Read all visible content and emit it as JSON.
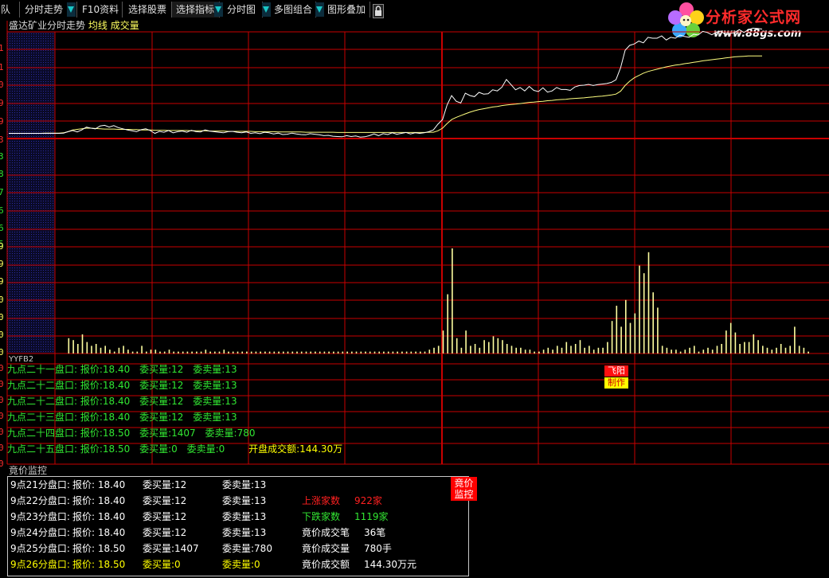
{
  "toolbar": {
    "items": [
      {
        "label": "队",
        "dropdown": false
      },
      {
        "label": "分时走势",
        "dropdown": true
      },
      {
        "label": "F10资料",
        "dropdown": true
      },
      {
        "label": "选择股票",
        "dropdown": false
      },
      {
        "label": "选择指标",
        "dropdown": false
      },
      {
        "label": "分时图",
        "dropdown": false
      },
      {
        "label": "多图组合",
        "dropdown": true
      },
      {
        "label": "图形叠加",
        "dropdown": true
      }
    ],
    "lock_icon": "lock-icon"
  },
  "logo": {
    "title": "分析家公式网",
    "url": "www.88gs.com",
    "icon": "flower-logo-icon"
  },
  "chart_header": {
    "stock": "盛达矿业",
    "mode": "分时走势",
    "avg": "均线",
    "vol": "成交量"
  },
  "indicator_name": "YYFB2",
  "colors": {
    "grid": "#c80000",
    "price": "#ffffff",
    "avg": "#ffff80",
    "volume": "#ffffa0",
    "green": "#32e632",
    "yellow": "#ffff00",
    "red": "#ff2020",
    "panel_border": "#c8c8c8"
  },
  "chart_data": {
    "type": "line",
    "series": [
      {
        "values": [
          0.18,
          0.18,
          0.18,
          0.18,
          0.18,
          0.18,
          0.18,
          0.18,
          0.18,
          0.18,
          0.18,
          0.18,
          0.19,
          0.24,
          0.28,
          0.23,
          0.3,
          0.4,
          0.36,
          0.34,
          0.44,
          0.46,
          0.4,
          0.45,
          0.38,
          0.34,
          0.3,
          0.27,
          0.24,
          0.31,
          0.34,
          0.28,
          0.18,
          0.25,
          0.22,
          0.28,
          0.2,
          0.24,
          0.26,
          0.22,
          0.29,
          0.24,
          0.23,
          0.3,
          0.26,
          0.24,
          0.22,
          0.2,
          0.24,
          0.25,
          0.22,
          0.2,
          0.23,
          0.18,
          0.2,
          0.17,
          0.22,
          0.2,
          0.16,
          0.19,
          0.14,
          0.15,
          0.19,
          0.16,
          0.14,
          0.13,
          0.17,
          0.15,
          0.13,
          0.1,
          0.11,
          0.08,
          0.07,
          0.06,
          0.1,
          0.07,
          0.09,
          0.05,
          0.06,
          0.1,
          0.16,
          0.1,
          0.17,
          0.14,
          0.2,
          0.15,
          0.18,
          0.21,
          0.16,
          0.2,
          0.18,
          0.2,
          0.24,
          0.3,
          0.5,
          0.66,
          1.17,
          1.5,
          1.3,
          1.24,
          1.58,
          1.5,
          1.46,
          1.61,
          1.55,
          1.56,
          1.7,
          1.66,
          1.79,
          2.06,
          1.88,
          1.7,
          1.78,
          1.66,
          1.82,
          1.68,
          1.64,
          1.77,
          1.62,
          1.66,
          1.78,
          1.71,
          1.71,
          1.68,
          1.8,
          1.85,
          1.86,
          1.89,
          1.85,
          1.88,
          1.9,
          1.92,
          1.96,
          2.05,
          2.47,
          3.08,
          3.25,
          3.3,
          3.4,
          3.34,
          3.53,
          3.5,
          3.5,
          3.58,
          3.44,
          3.53,
          3.5,
          3.61,
          3.56,
          3.53,
          3.64,
          3.61,
          3.74,
          3.7,
          3.62,
          3.71,
          3.75,
          3.61,
          3.66,
          3.7,
          3.8,
          3.7,
          3.8,
          3.85,
          3.84,
          3.82
        ]
      },
      {
        "values": [
          0.18,
          0.18,
          0.18,
          0.18,
          0.18,
          0.18,
          0.18,
          0.18,
          0.19,
          0.19,
          0.19,
          0.19,
          0.2,
          0.24,
          0.3,
          0.32,
          0.34,
          0.36,
          0.36,
          0.35,
          0.34,
          0.33,
          0.33,
          0.33,
          0.32,
          0.32,
          0.32,
          0.31,
          0.31,
          0.3,
          0.3,
          0.3,
          0.29,
          0.29,
          0.29,
          0.28,
          0.28,
          0.28,
          0.28,
          0.28,
          0.27,
          0.27,
          0.27,
          0.27,
          0.26,
          0.26,
          0.26,
          0.26,
          0.25,
          0.25,
          0.25,
          0.25,
          0.25,
          0.25,
          0.24,
          0.24,
          0.24,
          0.24,
          0.24,
          0.23,
          0.23,
          0.23,
          0.23,
          0.23,
          0.23,
          0.22,
          0.22,
          0.22,
          0.22,
          0.22,
          0.22,
          0.22,
          0.21,
          0.21,
          0.21,
          0.21,
          0.21,
          0.21,
          0.21,
          0.21,
          0.21,
          0.21,
          0.21,
          0.21,
          0.21,
          0.21,
          0.21,
          0.21,
          0.21,
          0.21,
          0.21,
          0.21,
          0.22,
          0.22,
          0.27,
          0.36,
          0.52,
          0.66,
          0.74,
          0.8,
          0.86,
          0.92,
          0.97,
          1.01,
          1.04,
          1.07,
          1.1,
          1.12,
          1.15,
          1.17,
          1.19,
          1.2,
          1.22,
          1.24,
          1.26,
          1.27,
          1.29,
          1.3,
          1.32,
          1.33,
          1.35,
          1.36,
          1.37,
          1.39,
          1.4,
          1.41,
          1.42,
          1.44,
          1.45,
          1.47,
          1.48,
          1.5,
          1.52,
          1.55,
          1.65,
          1.85,
          2.0,
          2.12,
          2.2,
          2.28,
          2.34,
          2.38,
          2.42,
          2.46,
          2.5,
          2.53,
          2.56,
          2.58,
          2.61,
          2.63,
          2.66,
          2.68,
          2.71,
          2.73,
          2.75,
          2.77,
          2.79,
          2.81,
          2.83,
          2.85,
          2.86,
          2.87,
          2.88,
          2.88,
          2.88,
          2.88
        ]
      }
    ],
    "volume": [
      0,
      0,
      0,
      0,
      0,
      0,
      0,
      0,
      0,
      0,
      0,
      0,
      0,
      8,
      7,
      5,
      10,
      6,
      4,
      5,
      3,
      4,
      2,
      1,
      3,
      4,
      2,
      1,
      1,
      4,
      1,
      2,
      2,
      1,
      1,
      2,
      1,
      1,
      1,
      1,
      1,
      1,
      1,
      2,
      1,
      1,
      1,
      2,
      1,
      1,
      1,
      1,
      1,
      1,
      1,
      1,
      1,
      1,
      1,
      1,
      1,
      1,
      1,
      1,
      1,
      1,
      1,
      1,
      1,
      1,
      1,
      1,
      1,
      1,
      1,
      1,
      1,
      1,
      1,
      1,
      1,
      1,
      1,
      1,
      1,
      1,
      1,
      1,
      1,
      1,
      1,
      1,
      2,
      3,
      4,
      12,
      31,
      55,
      8,
      3,
      12,
      4,
      5,
      3,
      7,
      6,
      9,
      8,
      7,
      5,
      4,
      3,
      3,
      2,
      2,
      1,
      1,
      2,
      3,
      2,
      4,
      3,
      6,
      4,
      5,
      7,
      3,
      4,
      2,
      3,
      3,
      6,
      17,
      25,
      14,
      28,
      16,
      21,
      46,
      42,
      53,
      32,
      24,
      4,
      3,
      2,
      2,
      1,
      2,
      3,
      4,
      1,
      2,
      3,
      2,
      4,
      5,
      12,
      16,
      11,
      5,
      6,
      6,
      10,
      7,
      4,
      3,
      2,
      3,
      5,
      3,
      4,
      14,
      4,
      3,
      1
    ]
  },
  "indicator_lines": [
    {
      "prefix": "九点二十一盘口:",
      "price": "报价:18.40",
      "buy": "委买量:12",
      "sell": "委卖量:13"
    },
    {
      "prefix": "九点二十二盘口:",
      "price": "报价:18.40",
      "buy": "委买量:12",
      "sell": "委卖量:13"
    },
    {
      "prefix": "九点二十二盘口:",
      "price": "报价:18.40",
      "buy": "委买量:12",
      "sell": "委卖量:13"
    },
    {
      "prefix": "九点二十三盘口:",
      "price": "报价:18.40",
      "buy": "委买量:12",
      "sell": "委卖量:13"
    },
    {
      "prefix": "九点二十四盘口:",
      "price": "报价:18.50",
      "buy": "委买量:1407",
      "sell": "委卖量:780"
    },
    {
      "prefix": "九点二十五盘口:",
      "price": "报价:18.50",
      "buy": "委买量:0",
      "sell": "委卖量:0"
    }
  ],
  "open_amount": "开盘成交额:144.30万",
  "badges": {
    "feiyang": "飞阳",
    "zhizuo": "制作"
  },
  "auction": {
    "title": "竟价监控",
    "corner": [
      "竟价",
      "监控"
    ],
    "rows": [
      {
        "time": "9点21分盘口:",
        "price": "报价: 18.40",
        "buy": "委买量:12",
        "sell": "委卖量:13"
      },
      {
        "time": "9点22分盘口:",
        "price": "报价: 18.40",
        "buy": "委买量:12",
        "sell": "委卖量:13"
      },
      {
        "time": "9点23分盘口:",
        "price": "报价: 18.40",
        "buy": "委买量:12",
        "sell": "委卖量:13"
      },
      {
        "time": "9点24分盘口:",
        "price": "报价: 18.40",
        "buy": "委买量:12",
        "sell": "委卖量:13"
      },
      {
        "time": "9点25分盘口:",
        "price": "报价: 18.50",
        "buy": "委买量:1407",
        "sell": "委卖量:780"
      },
      {
        "time": "9点26分盘口:",
        "price": "报价: 18.50",
        "buy": "委买量:0",
        "sell": "委卖量:0"
      }
    ],
    "stats": [
      {
        "label": "上涨家数",
        "value": "922家"
      },
      {
        "label": "下跌家数",
        "value": "1119家"
      },
      {
        "label": "竟价成交笔",
        "value": "36笔"
      },
      {
        "label": "竟价成交量",
        "value": "780手"
      },
      {
        "label": "竟价成交额",
        "value": "144.30万元"
      }
    ]
  },
  "left_axis": {
    "price_labels": [
      "1",
      "1",
      "0",
      "9",
      "9",
      "3",
      "3",
      "8",
      "7",
      "6",
      "6",
      "5"
    ],
    "volume_labels": [
      "9",
      "9",
      "9",
      "0",
      "0",
      "0",
      "0"
    ],
    "indicator_labels": [
      "0",
      "0",
      "0",
      "0",
      "0",
      "0",
      "0"
    ]
  }
}
